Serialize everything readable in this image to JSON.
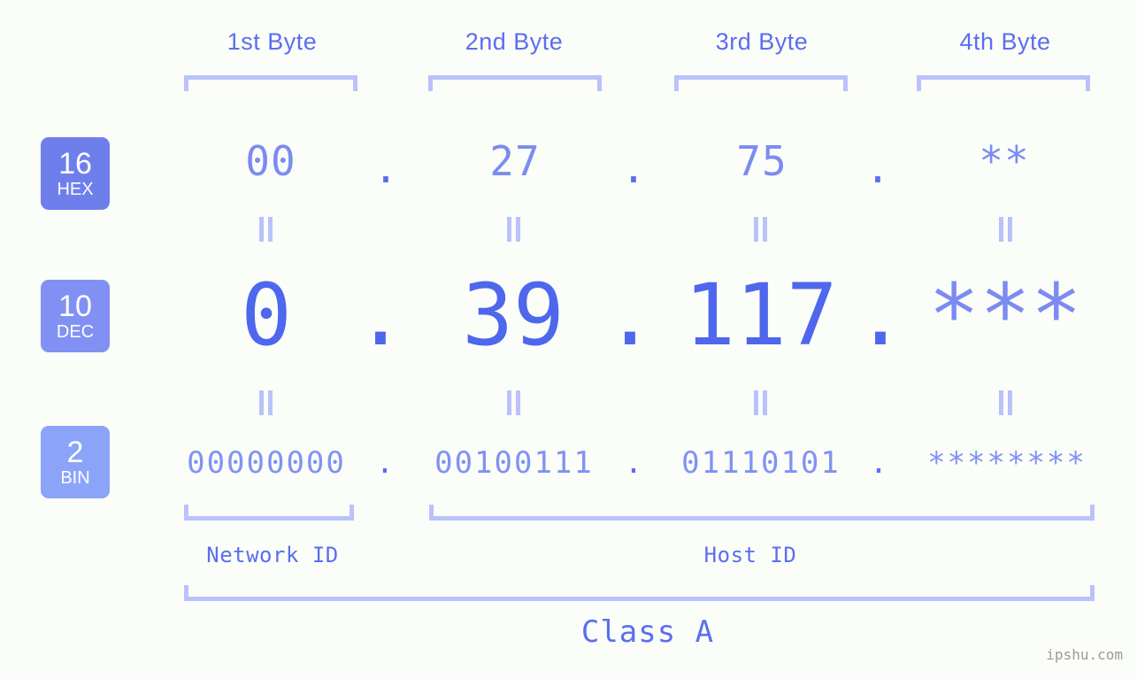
{
  "background_color": "#fbfdf8",
  "accent_color": "#5a6ef0",
  "bracket_color": "#b9c2fb",
  "columns": {
    "headers": [
      {
        "label": "1st Byte"
      },
      {
        "label": "2nd Byte"
      },
      {
        "label": "3rd Byte"
      },
      {
        "label": "4th Byte"
      }
    ]
  },
  "rows": [
    {
      "base_number": "16",
      "base_name": "HEX",
      "badge_color": "#6e7fec",
      "values": [
        "00",
        "27",
        "75",
        "**"
      ],
      "separator": "."
    },
    {
      "base_number": "10",
      "base_name": "DEC",
      "badge_color": "#8191f3",
      "values": [
        "0",
        "39",
        "117",
        "***"
      ],
      "separator": "."
    },
    {
      "base_number": "2",
      "base_name": "BIN",
      "badge_color": "#8ba4fa",
      "values": [
        "00000000",
        "00100111",
        "01110101",
        "********"
      ],
      "separator": "."
    }
  ],
  "id_sections": [
    {
      "label": "Network ID"
    },
    {
      "label": "Host ID"
    }
  ],
  "class_label": "Class A",
  "watermark": "ipshu.com"
}
